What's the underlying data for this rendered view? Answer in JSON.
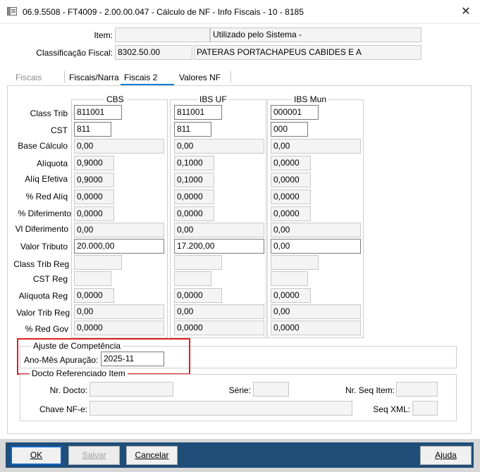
{
  "window": {
    "title": "06.9.5508 - FT4009 - 2.00.00.047 - Cálculo de NF - Info Fiscais - 10 - 8185",
    "close": "✕"
  },
  "header": {
    "item_label": "Item:",
    "item_code": "",
    "item_desc": "Utilizado pelo Sistema -",
    "class_label": "Classificação Fiscal:",
    "class_code": "8302.50.00",
    "class_desc": "PATERAS PORTACHAPEUS CABIDES E A"
  },
  "tabs": [
    {
      "label": "Fiscais"
    },
    {
      "label": "Fiscais/Narra"
    },
    {
      "label": "Fiscais 2"
    },
    {
      "label": "Valores NF"
    }
  ],
  "columns": {
    "cbs": "CBS",
    "ibs_uf": "IBS UF",
    "ibs_mun": "IBS Mun"
  },
  "rows": [
    {
      "label": "Class Trib",
      "cbs": "811001",
      "uf": "811001",
      "mun": "000001"
    },
    {
      "label": "CST",
      "cbs": "811",
      "uf": "811",
      "mun": "000"
    },
    {
      "label": "Base Cálculo",
      "cbs": "0,00",
      "uf": "0,00",
      "mun": "0,00"
    },
    {
      "label": "Alíquota",
      "cbs": "0,9000",
      "uf": "0,1000",
      "mun": "0,0000"
    },
    {
      "label": "Alíq Efetiva",
      "cbs": "0,9000",
      "uf": "0,1000",
      "mun": "0,0000"
    },
    {
      "label": "% Red Alíq",
      "cbs": "0,0000",
      "uf": "0,0000",
      "mun": "0,0000"
    },
    {
      "label": "% Diferimento",
      "cbs": "0,0000",
      "uf": "0,0000",
      "mun": "0,0000"
    },
    {
      "label": "Vl Diferimento",
      "cbs": "0,00",
      "uf": "0,00",
      "mun": "0,00"
    },
    {
      "label": "Valor Tributo",
      "cbs": "20.000,00",
      "uf": "17.200,00",
      "mun": "0,00"
    },
    {
      "label": "Class Trib Reg",
      "cbs": "",
      "uf": "",
      "mun": ""
    },
    {
      "label": "CST Reg",
      "cbs": "",
      "uf": "",
      "mun": ""
    },
    {
      "label": "Alíquota Reg",
      "cbs": "0,0000",
      "uf": "0,0000",
      "mun": "0,0000"
    },
    {
      "label": "Valor Trib Reg",
      "cbs": "0,00",
      "uf": "0,00",
      "mun": "0,00"
    },
    {
      "label": "% Red Gov",
      "cbs": "0,0000",
      "uf": "0,0000",
      "mun": "0,0000"
    }
  ],
  "ajuste": {
    "title": "Ajuste de Competência",
    "label": "Ano-Mês Apuração:",
    "value": "2025-11"
  },
  "docto": {
    "title": "Docto Referenciado Item",
    "nr_docto_label": "Nr. Docto:",
    "nr_docto_value": "",
    "serie_label": "Série:",
    "serie_value": "",
    "nr_seq_label": "Nr. Seq Item:",
    "nr_seq_value": "",
    "chave_label": "Chave NF-e:",
    "chave_value": "",
    "seq_xml_label": "Seq XML:",
    "seq_xml_value": ""
  },
  "buttons": {
    "ok": "OK",
    "salvar": "Salvar",
    "cancelar": "Cancelar",
    "ajuda": "Ajuda"
  },
  "colors": {
    "highlight": "#e02020",
    "footer_bar": "#1f4e79",
    "tab_accent": "#0a7fd4"
  }
}
